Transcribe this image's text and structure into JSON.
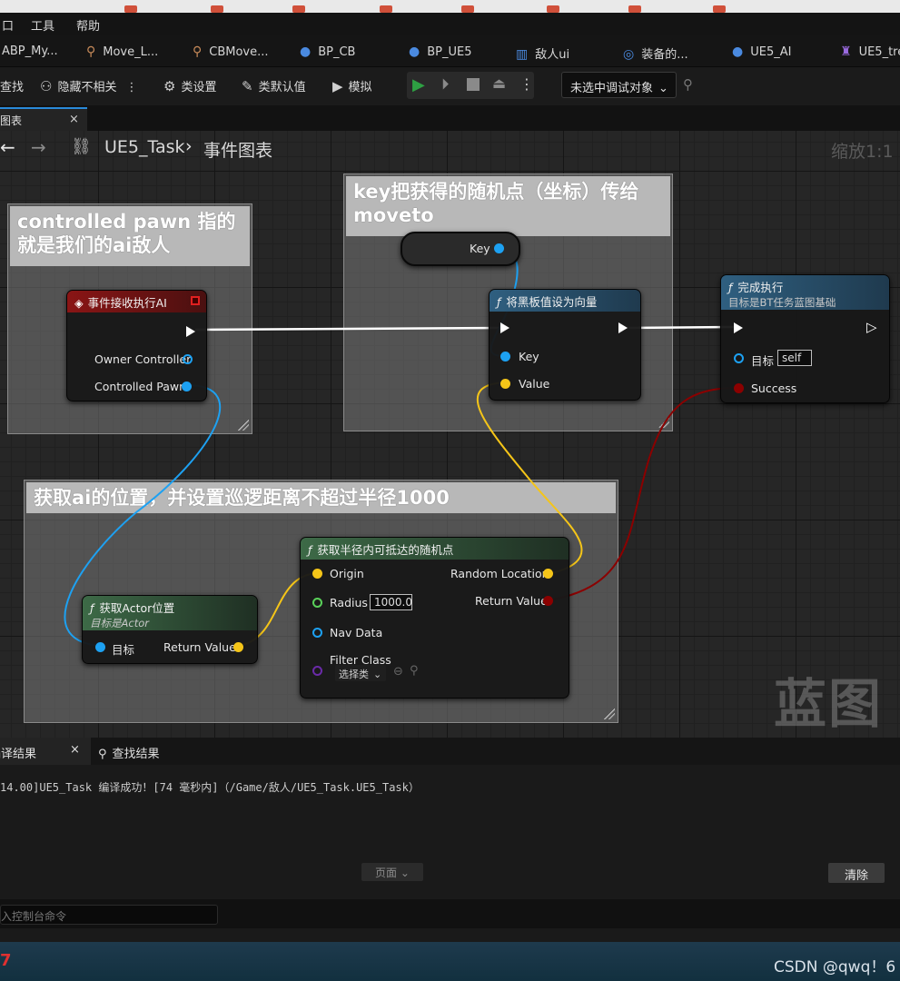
{
  "menu": {
    "items": [
      "口",
      "工具",
      "帮助"
    ]
  },
  "asset_tabs": [
    {
      "label": "ABP_My..."
    },
    {
      "label": "Move_L..."
    },
    {
      "label": "CBMove..."
    },
    {
      "label": "BP_CB"
    },
    {
      "label": "BP_UE5"
    },
    {
      "label": "敌人ui"
    },
    {
      "label": "装备的..."
    },
    {
      "label": "UE5_AI"
    },
    {
      "label": "UE5_tre"
    }
  ],
  "toolbar": {
    "find": "查找",
    "hide_unrelated": "隐藏不相关",
    "class_settings": "类设置",
    "class_defaults": "类默认值",
    "simulate": "模拟",
    "debug_select": "未选中调试对象"
  },
  "graph_tab": {
    "label": "图表"
  },
  "breadcrumb": {
    "asset": "UE5_Task",
    "graph": "事件图表",
    "zoom": "缩放1:1"
  },
  "comments": {
    "c1": "controlled pawn 指的就是我们的ai敌人",
    "c2": "key把获得的随机点（坐标）传给moveto",
    "c3": "获取ai的位置，并设置巡逻距离不超过半径1000"
  },
  "nodes": {
    "event": {
      "title": "事件接收执行AI",
      "pin_owner": "Owner Controller",
      "pin_pawn": "Controlled Pawn"
    },
    "key_var": {
      "label": "Key"
    },
    "set_bb": {
      "title": "将黑板值设为向量",
      "pin_key": "Key",
      "pin_value": "Value"
    },
    "finish": {
      "title": "完成执行",
      "subtitle": "目标是BT任务蓝图基础",
      "pin_target": "目标",
      "target_value": "self",
      "pin_success": "Success"
    },
    "get_actor_loc": {
      "title": "获取Actor位置",
      "subtitle": "目标是Actor",
      "pin_target": "目标",
      "pin_return": "Return Value"
    },
    "random_point": {
      "title": "获取半径内可抵达的随机点",
      "pin_origin": "Origin",
      "pin_radius": "Radius",
      "radius_value": "1000.0",
      "pin_navdata": "Nav Data",
      "pin_filter": "Filter Class",
      "filter_value": "选择类",
      "pin_random": "Random Location",
      "pin_return": "Return Value"
    }
  },
  "watermark": "蓝图",
  "log": {
    "tab_results": "编译结果",
    "tab_find": "查找结果",
    "line": "14.00]UE5_Task 编译成功！[74 毫秒内]（/Game/敌人/UE5_Task.UE5_Task）",
    "page_label": "页面",
    "clear_label": "清除",
    "console_placeholder": "入控制台命令"
  },
  "footer": {
    "credit": "CSDN @qwq！6"
  },
  "colors": {
    "exec": "#ffffff",
    "object": "#1da1f2",
    "vector": "#f5c518",
    "bool": "#8b0000",
    "float": "#5ad15a",
    "event_header": "#7a1010",
    "func_header_blue": "#2a4a63",
    "func_header_green": "#36533c"
  }
}
